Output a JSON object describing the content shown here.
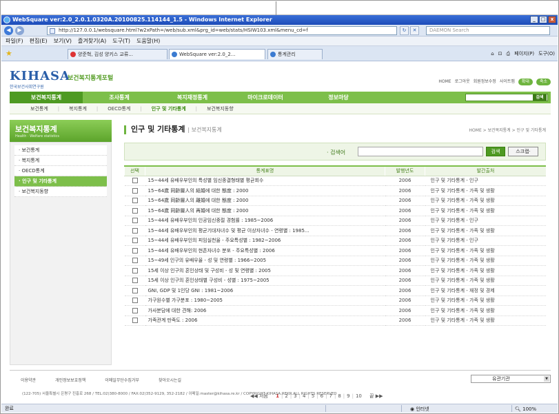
{
  "window": {
    "title": "WebSquare ver:2.0_2.0.1.0320A.20100825.114144_1.5 - Windows Internet Explorer",
    "controls": [
      "_",
      "□",
      "x"
    ]
  },
  "address": {
    "url": "http://127.0.0.1/websquare.html?w2xPath=/web/sub.xml&prg_id=web/stats/HSIW103.xml&menu_cd=f",
    "search_placeholder": "DAEMON Search"
  },
  "menu": [
    "파일(F)",
    "편집(E)",
    "보기(V)",
    "즐겨찾기(A)",
    "도구(T)",
    "도움말(H)"
  ],
  "tabs": [
    {
      "label": "양준혁, 김성 양키스 교류..."
    },
    {
      "label": "WebSquare ver:2.0_2..."
    },
    {
      "label": "통계관리"
    }
  ],
  "cmdbar": [
    "페이지(P)",
    "도구(O)"
  ],
  "site": {
    "logo": "KIHASA",
    "logo_sub": "한국보건사회연구원",
    "portal": "보건복지통계포털",
    "util_links": [
      "HOME",
      "로그아웃",
      "회원정보수정",
      "사이트맵"
    ],
    "util_buttons": [
      "확대",
      "축소"
    ],
    "gnb": [
      "보건복지통계",
      "조사통계",
      "복지재정통계",
      "마이크로데이터",
      "정보마당"
    ],
    "gnb_search_button": "검색",
    "lnb": [
      "보건통계",
      "복지통계",
      "OECD통계",
      "인구 및 기타통계",
      "보건복지동향"
    ]
  },
  "sidebar": {
    "title": "보건복지통계",
    "subtitle": "Health · Welfare statistics",
    "items": [
      "보건통계",
      "복지통계",
      "OECD통계",
      "인구 및 기타통계",
      "보건복지동향"
    ]
  },
  "main": {
    "title": "인구 및 기타통계",
    "subtitle": "보건복지통계",
    "breadcrumb": "HOME > 보건복지통계 > 인구 및 기타통계",
    "search_label": "· 검색어",
    "search_value": "",
    "search_button": "검색",
    "scrap_button": "스크랩·",
    "columns": [
      "선택",
      "통계표명",
      "발행년도",
      "발간출처"
    ],
    "rows": [
      {
        "name": "15~44세 유배우부인의 특성별 임신종결형태별 평균회수",
        "year": "2006",
        "source": "인구 및 기타통계 - 인구"
      },
      {
        "name": "15~64歲 同齡層人의 結婚에 대한 態度 : 2000",
        "year": "2006",
        "source": "인구 및 기타통계 - 가족 및 생활"
      },
      {
        "name": "15~64歲 同齡層人의 離婚에 대한 態度 : 2000",
        "year": "2006",
        "source": "인구 및 기타통계 - 가족 및 생활"
      },
      {
        "name": "15~64歲 同齡層人의 再婚에 대한 態度 : 2000",
        "year": "2006",
        "source": "인구 및 기타통계 - 가족 및 생활"
      },
      {
        "name": "15~44세 유배우부인의 인공임신중절 경험률 : 1985~2006",
        "year": "2006",
        "source": "인구 및 기타통계 - 인구"
      },
      {
        "name": "15~44세 유배우부인의 평균기대자녀수 및 평균 이상자녀수 - 연령별 : 1985...",
        "year": "2006",
        "source": "인구 및 기타통계 - 가족 및 생활"
      },
      {
        "name": "15~44세 유배우부인의 피임실천율 - 주요특성별 : 1982~2006",
        "year": "2006",
        "source": "인구 및 기타통계 - 인구"
      },
      {
        "name": "15~44세 유배우부인의 현존자녀수 분포 - 주요특성별 : 2006",
        "year": "2006",
        "source": "인구 및 기타통계 - 가족 및 생활"
      },
      {
        "name": "15~49세 인구의 유배우율 - 성 및 연령별 : 1966~2005",
        "year": "2006",
        "source": "인구 및 기타통계 - 가족 및 생활"
      },
      {
        "name": "15세 이상 인구의 혼인상태 및 구성비 - 성 및 연령별 : 2005",
        "year": "2006",
        "source": "인구 및 기타통계 - 가족 및 생활"
      },
      {
        "name": "15세 이상 인구의 혼인상태별 구성비 - 성별 : 1975~2005",
        "year": "2006",
        "source": "인구 및 기타통계 - 가족 및 생활"
      },
      {
        "name": "GNI, GDP 및 1인당 GNI : 1981~2006",
        "year": "2006",
        "source": "인구 및 기타통계 - 재정 및 경제"
      },
      {
        "name": "가구원수별 가구분포 : 1980~2005",
        "year": "2006",
        "source": "인구 및 기타통계 - 가족 및 생활"
      },
      {
        "name": "가사분담에 대한 견해: 2006",
        "year": "2006",
        "source": "인구 및 기타통계 - 가족 및 생활"
      },
      {
        "name": "가족관계 만족도 : 2006",
        "year": "2006",
        "source": "인구 및 기타통계 - 가족 및 생활"
      }
    ],
    "pager": {
      "first": "◀◀ 처음",
      "pages": [
        "1",
        "2",
        "3",
        "4",
        "5",
        "6",
        "7",
        "8",
        "9",
        "10"
      ],
      "current": "1",
      "last": "끝 ▶▶"
    }
  },
  "footer": {
    "links": [
      "이용약관",
      "개인정보보호정책",
      "이메일무단수집거부",
      "찾아오시는길"
    ],
    "related_select": "유관기관",
    "address": "(122-705) 서울특별시 은평구 진흥로 268 / TEL:02)380-8000 / FAX:02)352-9129, 352-2182 / 이메일:master@kihasa.re.kr / COPYRIGHT KIHASA.REKR.ALL RIGHTS RESERVED"
  },
  "status": {
    "left": "완료",
    "zone": "인터넷",
    "zoom": "100%"
  }
}
